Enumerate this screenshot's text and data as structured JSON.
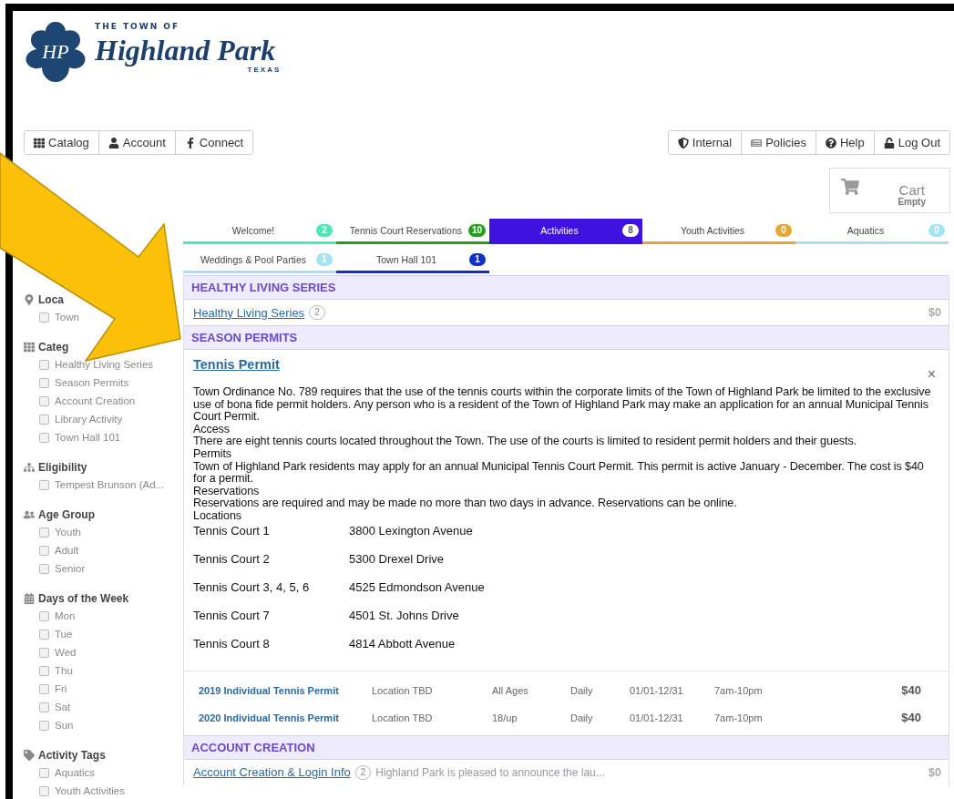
{
  "logo": {
    "monogram": "HP",
    "top_line": "THE TOWN OF",
    "name": "Highland Park",
    "state": "TEXAS"
  },
  "nav_left": [
    {
      "kind": "grid",
      "label": "Catalog"
    },
    {
      "kind": "user",
      "label": "Account"
    },
    {
      "kind": "facebook",
      "label": "Connect"
    }
  ],
  "nav_right": [
    {
      "kind": "shield",
      "label": "Internal"
    },
    {
      "kind": "newspaper",
      "label": "Policies"
    },
    {
      "kind": "help",
      "label": "Help"
    },
    {
      "kind": "unlock",
      "label": "Log Out"
    }
  ],
  "cart": {
    "title": "Cart",
    "status": "Empty"
  },
  "tab_rows": [
    {
      "tabs": [
        {
          "label": "Welcome!",
          "count": "2",
          "color": "#4ee8b4",
          "selected": false
        },
        {
          "label": "Tennis Court Reservations",
          "count": "10",
          "color": "#24a01c",
          "selected": false
        },
        {
          "label": "Activities",
          "count": "8",
          "color": "#3f12e0",
          "selected": true
        },
        {
          "label": "Youth Activities",
          "count": "0",
          "color": "#e2a838",
          "selected": false
        },
        {
          "label": "Aquatics",
          "count": "0",
          "color": "#a4e4f2",
          "selected": false
        }
      ]
    },
    {
      "tabs": [
        {
          "label": "Weddings & Pool Parties",
          "count": "1",
          "color": "#a4e4f2",
          "selected": false
        },
        {
          "label": "Town Hall 101",
          "count": "1",
          "color": "#1030c8",
          "selected": false
        }
      ]
    }
  ],
  "sidebar": {
    "groups": [
      {
        "kind": "location",
        "title": "Loca",
        "items": [
          {
            "label": "Town",
            "checked": false
          }
        ]
      },
      {
        "kind": "category",
        "title": "Categ",
        "items": [
          {
            "label": "Healthy Living Series",
            "checked": false
          },
          {
            "label": "Season Permits",
            "checked": false
          },
          {
            "label": "Account Creation",
            "checked": false
          },
          {
            "label": "Library Activity",
            "checked": false
          },
          {
            "label": "Town Hall 101",
            "checked": false
          }
        ]
      },
      {
        "kind": "eligibility",
        "title": "Eligibility",
        "items": [
          {
            "label": "Tempest Brunson (Ad...",
            "checked": false
          }
        ]
      },
      {
        "kind": "age",
        "title": "Age Group",
        "items": [
          {
            "label": "Youth",
            "checked": false
          },
          {
            "label": "Adult",
            "checked": false
          },
          {
            "label": "Senior",
            "checked": false
          }
        ]
      },
      {
        "kind": "days",
        "title": "Days of the Week",
        "items": [
          {
            "label": "Mon",
            "checked": false
          },
          {
            "label": "Tue",
            "checked": false
          },
          {
            "label": "Wed",
            "checked": false
          },
          {
            "label": "Thu",
            "checked": false
          },
          {
            "label": "Fri",
            "checked": false
          },
          {
            "label": "Sat",
            "checked": false
          },
          {
            "label": "Sun",
            "checked": false
          }
        ]
      },
      {
        "kind": "tags",
        "title": "Activity Tags",
        "items": [
          {
            "label": "Aquatics",
            "checked": false
          },
          {
            "label": "Youth Activities",
            "checked": false
          }
        ]
      }
    ]
  },
  "sections": [
    {
      "title": "HEALTHY LIVING SERIES",
      "items": [
        {
          "kind": "row",
          "name": "Healthy Living Series",
          "count": "2",
          "price": "$0"
        }
      ]
    },
    {
      "title": "SEASON PERMITS",
      "items": [
        {
          "kind": "detail",
          "name": "Tennis Permit",
          "close": "×",
          "description": [
            "Town Ordinance No. 789 requires that the use of the tennis courts within the corporate limits of the Town of Highland Park be limited to the exclusive use of bona fide permit holders.  Any person who is a resident of the Town of Highland Park may make an application for an annual Municipal Tennis Court Permit.",
            "Access",
            "There are eight tennis courts located throughout the Town. The use of the courts is limited to resident permit holders and their guests.",
            "Permits",
            "Town of Highland Park residents may apply for an annual Municipal Tennis Court Permit.  This permit is active January - December. The cost is $40 for a permit.",
            "Reservations",
            "Reservations are required and may be made no more than two days in advance. Reservations can be online.",
            "Locations"
          ],
          "locations": [
            {
              "court": "Tennis Court 1",
              "address": "3800 Lexington Avenue"
            },
            {
              "court": "Tennis Court 2",
              "address": "5300 Drexel Drive"
            },
            {
              "court": "Tennis Court 3, 4, 5, 6",
              "address": "4525 Edmondson Avenue"
            },
            {
              "court": "Tennis Court 7",
              "address": "4501 St. Johns Drive"
            },
            {
              "court": "Tennis Court 8",
              "address": "4814 Abbott Avenue"
            }
          ],
          "sessions": [
            {
              "name": "2019 Individual Tennis Permit",
              "location": "Location TBD",
              "ages": "All Ages",
              "days": "Daily",
              "dates": "01/01-12/31",
              "time": "7am-10pm",
              "price": "$40"
            },
            {
              "name": "2020 Individual Tennis Permit",
              "location": "Location TBD",
              "ages": "18/up",
              "days": "Daily",
              "dates": "01/01-12/31",
              "time": "7am-10pm",
              "price": "$40"
            }
          ]
        }
      ]
    },
    {
      "title": "ACCOUNT CREATION",
      "items": [
        {
          "kind": "row",
          "name": "Account Creation & Login Info",
          "count": "2",
          "summary": "Highland Park is pleased to announce the lau...",
          "price": "$0"
        }
      ]
    }
  ]
}
